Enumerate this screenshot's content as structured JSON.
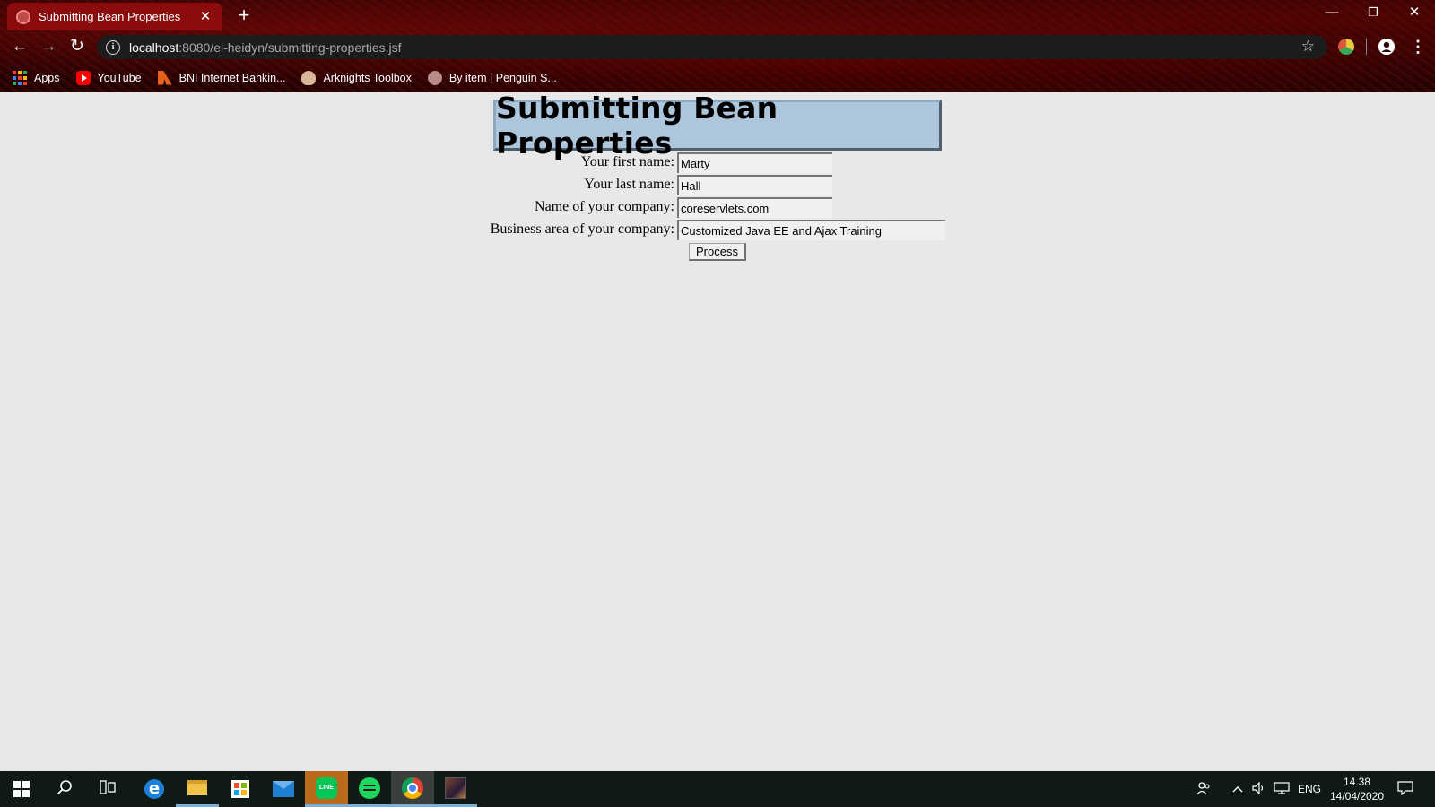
{
  "browser": {
    "tab_title": "Submitting Bean Properties",
    "url_host": "localhost",
    "url_path": ":8080/el-heidyn/submitting-properties.jsf",
    "bookmarks": [
      {
        "label": "Apps",
        "icon": "apps-grid-icon"
      },
      {
        "label": "YouTube",
        "icon": "youtube-icon"
      },
      {
        "label": "BNI Internet Bankin...",
        "icon": "bni-icon"
      },
      {
        "label": "Arknights Toolbox",
        "icon": "arknights-icon"
      },
      {
        "label": "By item | Penguin S...",
        "icon": "penguin-icon"
      }
    ]
  },
  "page": {
    "heading": "Submitting Bean Properties",
    "fields": [
      {
        "label": "Your first name:",
        "value": "Marty"
      },
      {
        "label": "Your last name:",
        "value": "Hall"
      },
      {
        "label": "Name of your company:",
        "value": "coreservlets.com"
      },
      {
        "label": "Business area of your company:",
        "value": "Customized Java EE and Ajax Training"
      }
    ],
    "submit_label": "Process"
  },
  "taskbar": {
    "language": "ENG",
    "time": "14.38",
    "date": "14/04/2020"
  },
  "colors": {
    "heading_bg": "#adc6dc",
    "page_bg": "#e8e8e8",
    "tab_bg": "#8a0c0c"
  }
}
